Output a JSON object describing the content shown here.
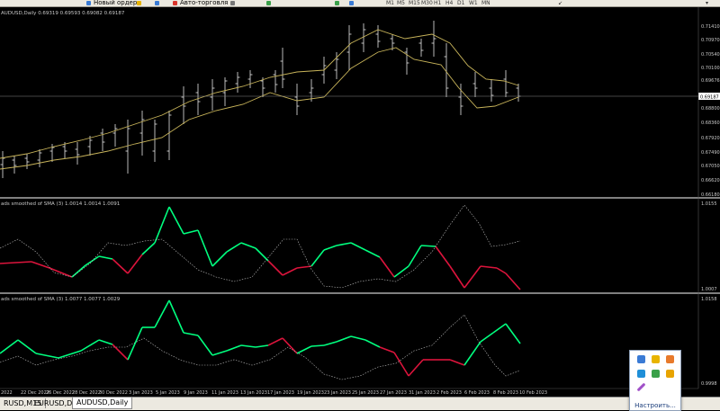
{
  "toolbar": {
    "new_order_label": "Новый ордер",
    "algo_label": "Авто-торговля",
    "timeframes": [
      "M1",
      "M5",
      "M15",
      "M30",
      "H1",
      "H4",
      "D1",
      "W1",
      "MN"
    ]
  },
  "main_chart": {
    "title": "AUDUSD,Daily  0.69319 0.69593 0.69082 0.69187",
    "current_price_label": "0.69187",
    "price_labels": [
      "0.71410",
      "0.70970",
      "0.70540",
      "0.70100",
      "0.69676",
      "0.69187",
      "0.68800",
      "0.68360",
      "0.67920",
      "0.67490",
      "0.67050",
      "0.66620",
      "0.66180"
    ]
  },
  "indicator1": {
    "title": "ads smoothed of   SMA (3) 1.0014 1.0014 1.0091",
    "scale_top": "1.0155",
    "scale_bottom": "1.0007"
  },
  "indicator2": {
    "title": "ads smoothed of   SMA (3) 1.0077 1.0077 1.0029",
    "scale_top": "1.0158",
    "scale_bottom": "0.9998"
  },
  "time_axis": [
    "2022",
    "22 Dec 2022",
    "26 Dec 2022",
    "28 Dec 2022",
    "30 Dec 2022",
    "3 Jan 2023",
    "5 Jan 2023",
    "9 Jan 2023",
    "11 Jan 2023",
    "13 Jan 2023",
    "17 Jan 2023",
    "19 Jan 2023",
    "23 Jan 2023",
    "25 Jan 2023",
    "27 Jan 2023",
    "31 Jan 2023",
    "2 Feb 2023",
    "6 Feb 2023",
    "8 Feb 2023",
    "10 Feb 2023"
  ],
  "tabs": [
    "RUSD,M15",
    "EURUSD,Daily",
    "AUDUSD,Daily"
  ],
  "popup": {
    "customize_label": "Настроить..."
  },
  "colors": {
    "bull": "#00ff7f",
    "bear": "#dc143c",
    "ma": "#c8b45a",
    "dotted": "#c0c0c0",
    "separator": "#ffffff"
  }
}
